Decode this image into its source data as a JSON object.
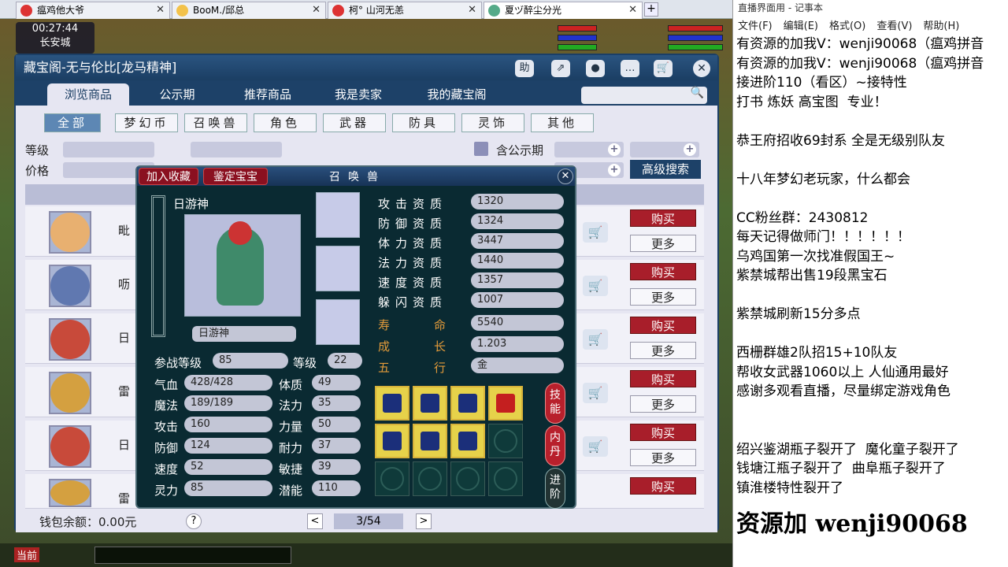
{
  "browser": {
    "tabs": [
      {
        "label": "瘟鸡他大爷"
      },
      {
        "label": "BooM./邱总"
      },
      {
        "label": "柯° 山河无恙"
      },
      {
        "label": "夏ヅ醉尘分光"
      }
    ],
    "new_tab": "+",
    "tab_close": "✕"
  },
  "game": {
    "clock": "00:27:44",
    "location": "长安城"
  },
  "panel": {
    "title": "藏宝阁-无与伦比[龙马精神]",
    "title_icons": [
      "助",
      "⇗",
      "●",
      "…",
      "🛒"
    ],
    "close": "✕",
    "nav": [
      "浏览商品",
      "公示期",
      "推荐商品",
      "我是卖家",
      "我的藏宝阁"
    ],
    "search_icon": "🔍",
    "categories": [
      "全部",
      "梦幻币",
      "召唤兽",
      "角色",
      "武器",
      "防具",
      "灵饰",
      "其他"
    ],
    "filters": {
      "level": "等级",
      "price": "价格",
      "public": "含公示期",
      "adv": "高级搜索"
    },
    "rows": [
      {
        "name": "毗",
        "buy": "购买",
        "more": "更多"
      },
      {
        "name": "呖",
        "buy": "购买",
        "more": "更多"
      },
      {
        "name": "日",
        "buy": "购买",
        "more": "更多"
      },
      {
        "name": "雷",
        "buy": "购买",
        "more": "更多"
      },
      {
        "name": "日",
        "buy": "购买",
        "more": "更多"
      },
      {
        "name": "雷",
        "buy": "购买",
        "more": ""
      }
    ],
    "wallet": "钱包余额：0.00元",
    "help": "?",
    "page": "3/54",
    "prev": "<",
    "next": ">"
  },
  "popup": {
    "tab_collect": "加入收藏",
    "tab_appraise": "鉴定宝宝",
    "title": "召唤兽",
    "close": "✕",
    "name": "日游神",
    "name_box": "日游神",
    "battle_level_label": "参战等级",
    "battle_level": "85",
    "level_label": "等级",
    "level": "22",
    "stats": [
      {
        "label": "气血",
        "value": "428/428"
      },
      {
        "label": "魔法",
        "value": "189/189"
      },
      {
        "label": "攻击",
        "value": "160"
      },
      {
        "label": "防御",
        "value": "124"
      },
      {
        "label": "速度",
        "value": "52"
      },
      {
        "label": "灵力",
        "value": "85"
      }
    ],
    "attrs": [
      {
        "label": "体质",
        "value": "49"
      },
      {
        "label": "法力",
        "value": "35"
      },
      {
        "label": "力量",
        "value": "50"
      },
      {
        "label": "耐力",
        "value": "37"
      },
      {
        "label": "敏捷",
        "value": "39"
      },
      {
        "label": "潜能",
        "value": "110"
      }
    ],
    "aptitudes": [
      {
        "label": "攻击资质",
        "value": "1320"
      },
      {
        "label": "防御资质",
        "value": "1324"
      },
      {
        "label": "体力资质",
        "value": "3447"
      },
      {
        "label": "法力资质",
        "value": "1440"
      },
      {
        "label": "速度资质",
        "value": "1357"
      },
      {
        "label": "躲闪资质",
        "value": "1007"
      }
    ],
    "orange": [
      {
        "label": "寿命",
        "value": "5540"
      },
      {
        "label": "成长",
        "value": "1.203"
      },
      {
        "label": "五行",
        "value": "金"
      }
    ],
    "side_buttons": [
      "技能",
      "内丹",
      "进阶"
    ]
  },
  "notepad": {
    "title": "直播界面用 - 记事本",
    "menu": [
      "文件(F)",
      "编辑(E)",
      "格式(O)",
      "查看(V)",
      "帮助(H)"
    ],
    "lines": [
      "有资源的加我V：wenji90068（瘟鸡拼音",
      "有资源的加我V：wenji90068（瘟鸡拼音",
      "接进阶110（看区）~接特性",
      "打书 炼妖 高宝图  专业！",
      "",
      "恭王府招收69封系 全是无级别队友",
      "",
      "十八年梦幻老玩家，什么都会",
      "",
      "CC粉丝群：2430812",
      "每天记得做师门！！！！！！",
      "乌鸡国第一次找准假国王~",
      "紫禁城帮出售19段黑宝石",
      "",
      "紫禁城刷新15分多点",
      "",
      "西栅群雄2队招15+10队友",
      "帮收女武器1060以上 人仙通用最好",
      "感谢多观看直播，尽量绑定游戏角色",
      "",
      "",
      "绍兴鉴湖瓶子裂开了  魔化童子裂开了",
      "钱塘江瓶子裂开了  曲阜瓶子裂开了",
      "镇淮楼特性裂开了"
    ],
    "big": "资源加 wenji90068"
  },
  "taskbar": {
    "label": "当前"
  }
}
